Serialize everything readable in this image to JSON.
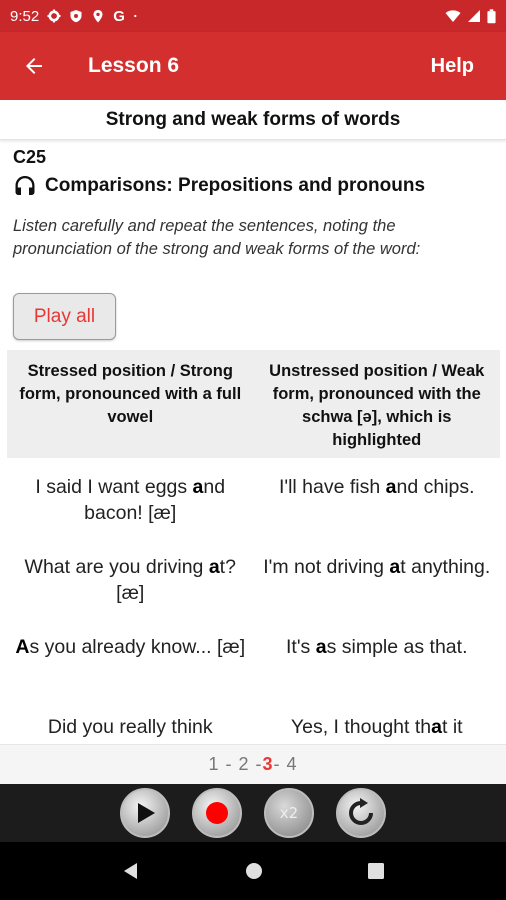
{
  "status_bar": {
    "time": "9:52",
    "left_icons": [
      "gear-icon",
      "shield-icon",
      "location-icon",
      "google-icon",
      "dot-icon"
    ],
    "google_letter": "G",
    "right_icons": [
      "wifi-icon",
      "signal-icon",
      "battery-icon"
    ]
  },
  "app_bar": {
    "title": "Lesson 6",
    "help_label": "Help",
    "back_icon": "arrow-left-icon"
  },
  "lesson_subtitle": "Strong and weak forms of words",
  "exercise": {
    "code": "C25",
    "section_icon": "headphones-icon",
    "section_title": "Comparisons: Prepositions and pronouns",
    "instructions": "Listen carefully and repeat the sentences, noting the pronunciation of the strong and weak forms of the word:",
    "play_all_label": "Play all"
  },
  "table": {
    "headers": [
      "Stressed position / Strong form, pronounced with a full vowel",
      "Unstressed position / Weak form, pronounced with the schwa [ə], which is highlighted"
    ],
    "rows": [
      {
        "strong": {
          "before": "I said I want eggs ",
          "bold": "a",
          "after": "nd bacon! [æ]"
        },
        "weak": {
          "before": "I'll have fish ",
          "bold": "a",
          "after": "nd chips."
        }
      },
      {
        "strong": {
          "before": "What are you driving ",
          "bold": "a",
          "after": "t? [æ]"
        },
        "weak": {
          "before": "I'm not driving ",
          "bold": "a",
          "after": "t anything."
        }
      },
      {
        "strong": {
          "before": "",
          "bold": "A",
          "after": "s you already know... [æ]"
        },
        "weak": {
          "before": "It's ",
          "bold": "a",
          "after": "s simple as that."
        }
      },
      {
        "strong": {
          "before": "Did you really think ",
          "bold": "",
          "after": ""
        },
        "weak": {
          "before": "Yes, I thought th",
          "bold": "a",
          "after": "t it"
        }
      }
    ]
  },
  "pager": {
    "prefix": "1 - 2 - ",
    "current": "3",
    "suffix": " - 4"
  },
  "player_controls": {
    "play_icon": "play-icon",
    "record_icon": "record-icon",
    "speed_label": "x2",
    "replay_icon": "replay-icon",
    "record_color": "#ff0000"
  },
  "nav_bar": {
    "back_icon": "nav-back-icon",
    "home_icon": "nav-home-icon",
    "recents_icon": "nav-recents-icon"
  },
  "colors": {
    "app_bar": "#d32f2f",
    "status_bar": "#c8282a",
    "accent_red": "#e53935"
  }
}
